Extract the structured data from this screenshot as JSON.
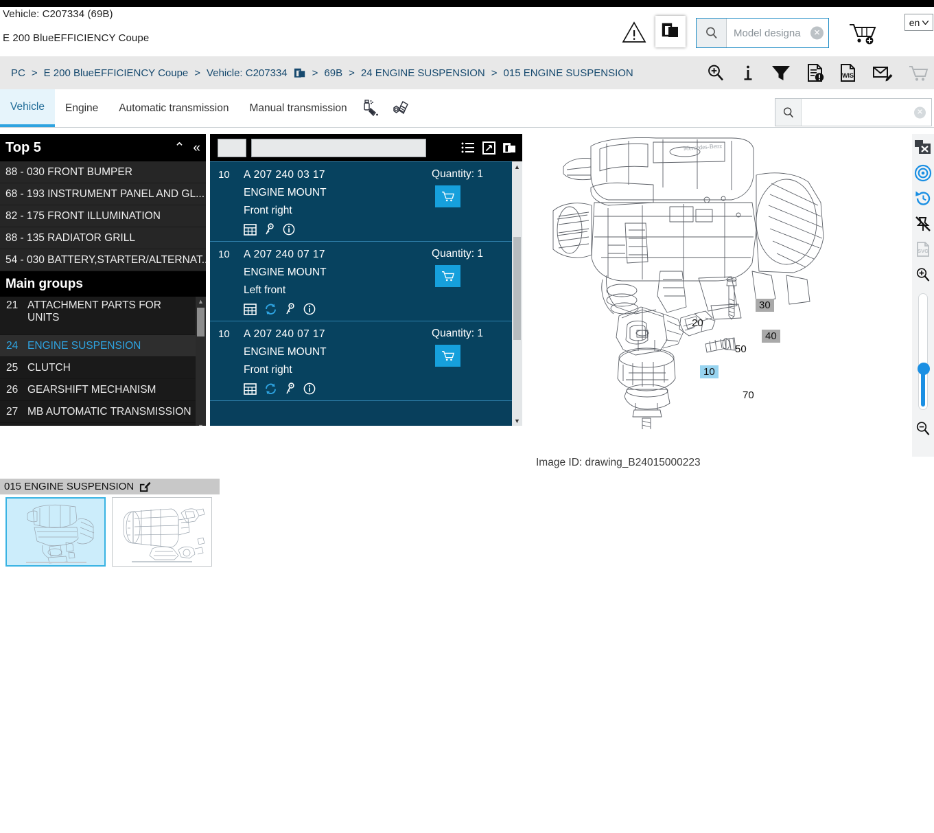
{
  "header": {
    "vehicle_line1": "Vehicle: C207334 (69B)",
    "vehicle_line2": "E 200 BlueEFFICIENCY Coupe",
    "warning_icon": "warning-triangle-icon",
    "copy_icon": "copy-documents-icon",
    "model_search": {
      "placeholder": "Model designa",
      "search_icon": "search-icon",
      "clear_icon": "clear-x-icon"
    },
    "cart_icon": "cart-add-icon",
    "language": "en"
  },
  "breadcrumb": {
    "items": [
      "PC",
      "E 200 BlueEFFICIENCY Coupe",
      "Vehicle: C207334",
      "69B",
      "24 ENGINE SUSPENSION",
      "015 ENGINE SUSPENSION"
    ],
    "separator": ">",
    "copy_icon": "copy-documents-icon",
    "tools": [
      "zoom-in-magnifier-icon",
      "info-icon",
      "filter-funnel-icon",
      "document-alert-icon",
      "wis-document-icon",
      "mail-edit-icon",
      "shopping-cart-icon"
    ]
  },
  "tabs": {
    "items": [
      {
        "label": "Vehicle",
        "active": true
      },
      {
        "label": "Engine",
        "active": false
      },
      {
        "label": "Automatic transmission",
        "active": false
      },
      {
        "label": "Manual transmission",
        "active": false
      }
    ],
    "icons": [
      "paint-spray-can-icon",
      "bolt-fastener-icon"
    ],
    "search": {
      "value": "",
      "search_icon": "search-icon",
      "clear_icon": "clear-x-icon"
    }
  },
  "sidebar": {
    "top5": {
      "title": "Top 5",
      "collapse_icon": "chevron-up-icon",
      "collapse_all_icon": "double-chevron-left-icon",
      "items": [
        "88 - 030 FRONT BUMPER",
        "68 - 193 INSTRUMENT PANEL AND GL...",
        "82 - 175 FRONT ILLUMINATION",
        "88 - 135 RADIATOR GRILL",
        "54 - 030 BATTERY,STARTER/ALTERNAT..."
      ]
    },
    "main_groups": {
      "title": "Main groups",
      "items": [
        {
          "num": "21",
          "label": "ATTACHMENT PARTS FOR UNITS",
          "selected": false,
          "tall": true
        },
        {
          "num": "24",
          "label": "ENGINE SUSPENSION",
          "selected": true,
          "tall": false
        },
        {
          "num": "25",
          "label": "CLUTCH",
          "selected": false,
          "tall": false
        },
        {
          "num": "26",
          "label": "GEARSHIFT MECHANISM",
          "selected": false,
          "tall": false
        },
        {
          "num": "27",
          "label": "MB AUTOMATIC TRANSMISSION",
          "selected": false,
          "tall": false
        }
      ]
    }
  },
  "parts_panel": {
    "filter_small_value": "",
    "filter_big_value": "",
    "actions": [
      "list-view-icon",
      "expand-arrows-icon",
      "copy-documents-icon"
    ],
    "rows": [
      {
        "num": "10",
        "ref": "A 207 240 03  17",
        "name": "ENGINE MOUNT",
        "position": "Front right",
        "quantity_label": "Quantity: 1",
        "cart_icon": "cart-icon",
        "icons": [
          "table-grid-icon",
          "key-icon",
          "info-circle-icon"
        ]
      },
      {
        "num": "10",
        "ref": "A 207 240 07  17",
        "name": "ENGINE MOUNT",
        "position": "Left front",
        "quantity_label": "Quantity: 1",
        "cart_icon": "cart-icon",
        "icons": [
          "table-grid-icon",
          "refresh-replace-icon",
          "key-icon",
          "info-circle-icon"
        ]
      },
      {
        "num": "10",
        "ref": "A 207 240 07  17",
        "name": "ENGINE MOUNT",
        "position": "Front right",
        "quantity_label": "Quantity: 1",
        "cart_icon": "cart-icon",
        "icons": [
          "table-grid-icon",
          "refresh-replace-icon",
          "key-icon",
          "info-circle-icon"
        ]
      }
    ]
  },
  "drawing": {
    "image_id": "Image ID: drawing_B24015000223",
    "callouts": [
      {
        "label": "50",
        "style": "plain"
      },
      {
        "label": "30",
        "style": "gray"
      },
      {
        "label": "20",
        "style": "plain"
      },
      {
        "label": "40",
        "style": "gray"
      },
      {
        "label": "10",
        "style": "blue"
      },
      {
        "label": "70",
        "style": "plain"
      }
    ]
  },
  "vertical_toolbar": {
    "items": [
      "close-window-icon",
      "target-focus-icon",
      "history-undo-icon",
      "unpin-icon",
      "svg-export-icon",
      "zoom-in-icon"
    ],
    "slider_name": "zoom-slider",
    "zoom_out_icon": "zoom-out-icon"
  },
  "thumbnails": {
    "title": "015 ENGINE SUSPENSION",
    "edit_icon": "edit-pencil-icon",
    "items": [
      {
        "name": "engine-suspension-drawing-1",
        "selected": true
      },
      {
        "name": "transmission-suspension-drawing-2",
        "selected": false
      }
    ]
  },
  "colors": {
    "accent_blue": "#1a8fe3",
    "panel_dark_blue": "#07425f",
    "sidebar_black": "#000000",
    "crumb_text": "#16496e"
  }
}
